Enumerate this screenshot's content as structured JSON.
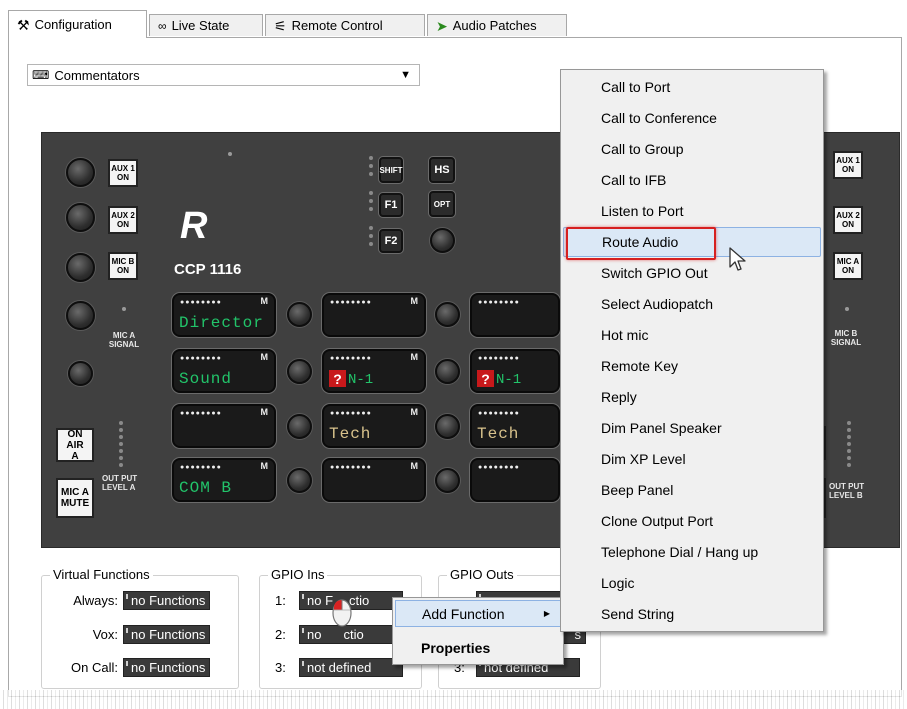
{
  "tabs": [
    {
      "label": "Configuration",
      "icon": "tools-icon"
    },
    {
      "label": "Live State",
      "icon": "glasses-icon"
    },
    {
      "label": "Remote Control",
      "icon": "remote-icon"
    },
    {
      "label": "Audio Patches",
      "icon": "patch-icon"
    }
  ],
  "panel_select": {
    "value": "Commentators",
    "icon": "keyboard-icon"
  },
  "device": {
    "brand": "R",
    "model": "CCP 1116",
    "left_buttons": [
      "AUX 1\nON",
      "AUX 2\nON",
      "MIC B\nON"
    ],
    "right_buttons": [
      "AUX 1\nON",
      "AUX 2\nON",
      "MIC A\nON"
    ],
    "mic_a_signal": "MIC A\nSIGNAL",
    "mic_b_signal": "MIC B\nSIGNAL",
    "on_air": "ON AIR\nA",
    "on_air_b_fragment": "R",
    "mic_mute": "MIC A\nMUTE",
    "output_level_a": "OUT PUT\nLEVEL A",
    "output_level_b": "OUT PUT\nLEVEL B",
    "shift": "SHIFT",
    "hs": "HS",
    "f1": "F1",
    "opt": "OPT",
    "f2": "F2",
    "display_dots": "●●●●●●●●",
    "display_m": "M",
    "qmark": "?",
    "displays": {
      "r1c1": "Director",
      "r2c1": "Sound",
      "r2c2": "N-1",
      "r2c3": "N-1",
      "r3c2": "Tech",
      "r3c3": "Tech",
      "r4c1": "COM B"
    }
  },
  "virtual_functions": {
    "title": "Virtual Functions",
    "rows": [
      {
        "label": "Always:",
        "value": "no Functions"
      },
      {
        "label": "Vox:",
        "value": "no Functions"
      },
      {
        "label": "On Call:",
        "value": "no Functions"
      }
    ]
  },
  "gpio_ins": {
    "title": "GPIO Ins",
    "rows": [
      {
        "label": "1:",
        "value": "no F",
        "value_tail": "ctio"
      },
      {
        "label": "2:",
        "value": "no",
        "value_tail": "ctio"
      },
      {
        "label": "3:",
        "value": "not defined"
      }
    ]
  },
  "gpio_outs": {
    "title": "GPIO Outs",
    "rows": [
      {
        "label": "3:",
        "value": "not defined"
      }
    ],
    "fragment_2": "s"
  },
  "small_menu": {
    "items": [
      {
        "label": "Add Function",
        "arrow": "▶"
      },
      {
        "label": "Properties"
      }
    ]
  },
  "function_menu": {
    "items": [
      "Call to Port",
      "Call to Conference",
      "Call to Group",
      "Call to IFB",
      "Listen to Port",
      "Route Audio",
      "Switch GPIO Out",
      "Select Audiopatch",
      "Hot mic",
      "Remote Key",
      "Reply",
      "Dim Panel Speaker",
      "Dim XP Level",
      "Beep Panel",
      "Clone Output Port",
      "Telephone Dial / Hang up",
      "Logic",
      "Send String"
    ],
    "highlighted": "Route Audio"
  },
  "colors": {
    "highlight_outline": "#d62020",
    "menu_hover": "#dbe8f6",
    "display_green": "#22c46a"
  }
}
